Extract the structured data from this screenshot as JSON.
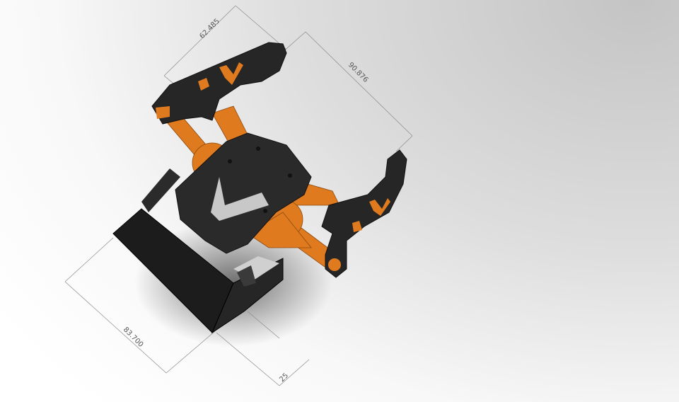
{
  "dimensions": {
    "top_width": "62.485",
    "right_length": "90.876",
    "base_length": "83.700",
    "base_height": "25"
  },
  "colors": {
    "orange": "#e07a1f",
    "black": "#242424"
  }
}
